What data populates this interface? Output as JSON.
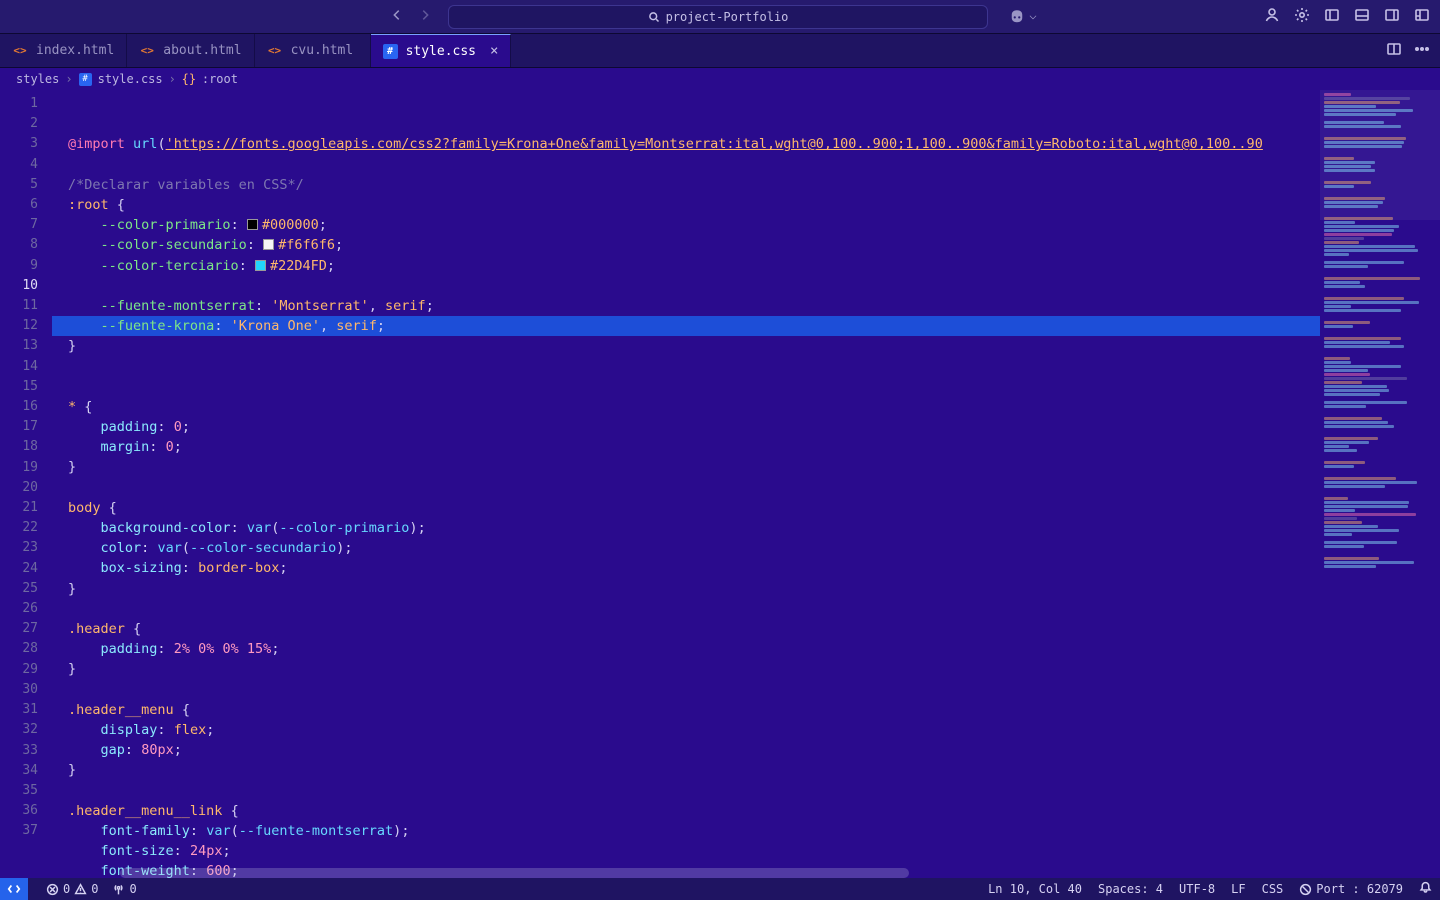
{
  "titlebar": {
    "project": "project-Portfolio"
  },
  "tabs": [
    {
      "label": "index.html",
      "icon": "html",
      "active": false
    },
    {
      "label": "about.html",
      "icon": "html",
      "active": false
    },
    {
      "label": "cvu.html",
      "icon": "html",
      "active": false
    },
    {
      "label": "style.css",
      "icon": "css",
      "active": true,
      "closeable": true
    }
  ],
  "breadcrumb": {
    "folder": "styles",
    "file": "style.css",
    "symbol": ":root"
  },
  "editor": {
    "highlighted_line": 10,
    "lines": [
      {
        "n": 1,
        "tokens": [
          {
            "t": "@import",
            "c": "tok-kw"
          },
          {
            "t": " ",
            "c": ""
          },
          {
            "t": "url",
            "c": "tok-fn"
          },
          {
            "t": "(",
            "c": "tok-punc"
          },
          {
            "t": "'https://fonts.googleapis.com/css2?family=Krona+One&family=Montserrat:ital,wght@0,100..900;1,100..900&family=Roboto:ital,wght@0,100..90",
            "c": "tok-str"
          }
        ]
      },
      {
        "n": 2,
        "tokens": []
      },
      {
        "n": 3,
        "tokens": [
          {
            "t": "/*Declarar variables en CSS*/",
            "c": "tok-com"
          }
        ]
      },
      {
        "n": 4,
        "tokens": [
          {
            "t": ":root",
            "c": "tok-sel"
          },
          {
            "t": " ",
            "c": ""
          },
          {
            "t": "{",
            "c": "tok-punc"
          }
        ]
      },
      {
        "n": 5,
        "indent": 1,
        "tokens": [
          {
            "t": "--color-primario",
            "c": "tok-propv"
          },
          {
            "t": ":",
            "c": "tok-punc"
          },
          {
            "t": " ",
            "c": ""
          },
          {
            "swatch": "#000000"
          },
          {
            "t": "#000000",
            "c": "tok-val"
          },
          {
            "t": ";",
            "c": "tok-punc"
          }
        ]
      },
      {
        "n": 6,
        "indent": 1,
        "tokens": [
          {
            "t": "--color-secundario",
            "c": "tok-propv"
          },
          {
            "t": ":",
            "c": "tok-punc"
          },
          {
            "t": " ",
            "c": ""
          },
          {
            "swatch": "#f6f6f6"
          },
          {
            "t": "#f6f6f6",
            "c": "tok-val"
          },
          {
            "t": ";",
            "c": "tok-punc"
          }
        ]
      },
      {
        "n": 7,
        "indent": 1,
        "tokens": [
          {
            "t": "--color-terciario",
            "c": "tok-propv"
          },
          {
            "t": ":",
            "c": "tok-punc"
          },
          {
            "t": " ",
            "c": ""
          },
          {
            "swatch": "#22D4FD"
          },
          {
            "t": "#22D4FD",
            "c": "tok-val"
          },
          {
            "t": ";",
            "c": "tok-punc"
          }
        ]
      },
      {
        "n": 8,
        "indent": 1,
        "tokens": []
      },
      {
        "n": 9,
        "indent": 1,
        "tokens": [
          {
            "t": "--fuente-montserrat",
            "c": "tok-propv"
          },
          {
            "t": ":",
            "c": "tok-punc"
          },
          {
            "t": " ",
            "c": ""
          },
          {
            "t": "'Montserrat'",
            "c": "tok-str-nou"
          },
          {
            "t": ", ",
            "c": "tok-punc"
          },
          {
            "t": "serif",
            "c": "tok-val"
          },
          {
            "t": ";",
            "c": "tok-punc"
          }
        ]
      },
      {
        "n": 10,
        "indent": 1,
        "tokens": [
          {
            "t": "--fuente-krona",
            "c": "tok-propv"
          },
          {
            "t": ":",
            "c": "tok-punc"
          },
          {
            "t": " ",
            "c": ""
          },
          {
            "t": "'Krona One'",
            "c": "tok-str-nou"
          },
          {
            "t": ", ",
            "c": "tok-punc"
          },
          {
            "t": "serif",
            "c": "tok-val"
          },
          {
            "t": ";",
            "c": "tok-punc"
          }
        ]
      },
      {
        "n": 11,
        "tokens": [
          {
            "t": "}",
            "c": "tok-punc"
          }
        ]
      },
      {
        "n": 12,
        "tokens": []
      },
      {
        "n": 13,
        "tokens": []
      },
      {
        "n": 14,
        "tokens": [
          {
            "t": "*",
            "c": "tok-sel"
          },
          {
            "t": " ",
            "c": ""
          },
          {
            "t": "{",
            "c": "tok-punc"
          }
        ]
      },
      {
        "n": 15,
        "indent": 1,
        "tokens": [
          {
            "t": "padding",
            "c": "tok-prop"
          },
          {
            "t": ":",
            "c": "tok-punc"
          },
          {
            "t": " ",
            "c": ""
          },
          {
            "t": "0",
            "c": "tok-num"
          },
          {
            "t": ";",
            "c": "tok-punc"
          }
        ]
      },
      {
        "n": 16,
        "indent": 1,
        "tokens": [
          {
            "t": "margin",
            "c": "tok-prop"
          },
          {
            "t": ":",
            "c": "tok-punc"
          },
          {
            "t": " ",
            "c": ""
          },
          {
            "t": "0",
            "c": "tok-num"
          },
          {
            "t": ";",
            "c": "tok-punc"
          }
        ]
      },
      {
        "n": 17,
        "tokens": [
          {
            "t": "}",
            "c": "tok-punc"
          }
        ]
      },
      {
        "n": 18,
        "tokens": []
      },
      {
        "n": 19,
        "tokens": [
          {
            "t": "body",
            "c": "tok-sel"
          },
          {
            "t": " ",
            "c": ""
          },
          {
            "t": "{",
            "c": "tok-punc"
          }
        ]
      },
      {
        "n": 20,
        "indent": 1,
        "tokens": [
          {
            "t": "background-color",
            "c": "tok-prop"
          },
          {
            "t": ":",
            "c": "tok-punc"
          },
          {
            "t": " ",
            "c": ""
          },
          {
            "t": "var",
            "c": "tok-fn"
          },
          {
            "t": "(",
            "c": "tok-punc"
          },
          {
            "t": "--color-primario",
            "c": "tok-var"
          },
          {
            "t": ")",
            "c": "tok-punc"
          },
          {
            "t": ";",
            "c": "tok-punc"
          }
        ]
      },
      {
        "n": 21,
        "indent": 1,
        "tokens": [
          {
            "t": "color",
            "c": "tok-prop"
          },
          {
            "t": ":",
            "c": "tok-punc"
          },
          {
            "t": " ",
            "c": ""
          },
          {
            "t": "var",
            "c": "tok-fn"
          },
          {
            "t": "(",
            "c": "tok-punc"
          },
          {
            "t": "--color-secundario",
            "c": "tok-var"
          },
          {
            "t": ")",
            "c": "tok-punc"
          },
          {
            "t": ";",
            "c": "tok-punc"
          }
        ]
      },
      {
        "n": 22,
        "indent": 1,
        "tokens": [
          {
            "t": "box-sizing",
            "c": "tok-prop"
          },
          {
            "t": ":",
            "c": "tok-punc"
          },
          {
            "t": " ",
            "c": ""
          },
          {
            "t": "border-box",
            "c": "tok-val"
          },
          {
            "t": ";",
            "c": "tok-punc"
          }
        ]
      },
      {
        "n": 23,
        "tokens": [
          {
            "t": "}",
            "c": "tok-punc"
          }
        ]
      },
      {
        "n": 24,
        "tokens": []
      },
      {
        "n": 25,
        "tokens": [
          {
            "t": ".header",
            "c": "tok-sel"
          },
          {
            "t": " ",
            "c": ""
          },
          {
            "t": "{",
            "c": "tok-punc"
          }
        ]
      },
      {
        "n": 26,
        "indent": 1,
        "tokens": [
          {
            "t": "padding",
            "c": "tok-prop"
          },
          {
            "t": ":",
            "c": "tok-punc"
          },
          {
            "t": " ",
            "c": ""
          },
          {
            "t": "2%",
            "c": "tok-num"
          },
          {
            "t": " ",
            "c": ""
          },
          {
            "t": "0%",
            "c": "tok-num"
          },
          {
            "t": " ",
            "c": ""
          },
          {
            "t": "0%",
            "c": "tok-num"
          },
          {
            "t": " ",
            "c": ""
          },
          {
            "t": "15%",
            "c": "tok-num"
          },
          {
            "t": ";",
            "c": "tok-punc"
          }
        ]
      },
      {
        "n": 27,
        "tokens": [
          {
            "t": "}",
            "c": "tok-punc"
          }
        ]
      },
      {
        "n": 28,
        "tokens": []
      },
      {
        "n": 29,
        "tokens": [
          {
            "t": ".header__menu",
            "c": "tok-sel"
          },
          {
            "t": " ",
            "c": ""
          },
          {
            "t": "{",
            "c": "tok-punc"
          }
        ]
      },
      {
        "n": 30,
        "indent": 1,
        "tokens": [
          {
            "t": "display",
            "c": "tok-prop"
          },
          {
            "t": ":",
            "c": "tok-punc"
          },
          {
            "t": " ",
            "c": ""
          },
          {
            "t": "flex",
            "c": "tok-val"
          },
          {
            "t": ";",
            "c": "tok-punc"
          }
        ]
      },
      {
        "n": 31,
        "indent": 1,
        "tokens": [
          {
            "t": "gap",
            "c": "tok-prop"
          },
          {
            "t": ":",
            "c": "tok-punc"
          },
          {
            "t": " ",
            "c": ""
          },
          {
            "t": "80px",
            "c": "tok-num"
          },
          {
            "t": ";",
            "c": "tok-punc"
          }
        ]
      },
      {
        "n": 32,
        "tokens": [
          {
            "t": "}",
            "c": "tok-punc"
          }
        ]
      },
      {
        "n": 33,
        "tokens": []
      },
      {
        "n": 34,
        "tokens": [
          {
            "t": ".header__menu__link",
            "c": "tok-sel"
          },
          {
            "t": " ",
            "c": ""
          },
          {
            "t": "{",
            "c": "tok-punc"
          }
        ]
      },
      {
        "n": 35,
        "indent": 1,
        "tokens": [
          {
            "t": "font-family",
            "c": "tok-prop"
          },
          {
            "t": ":",
            "c": "tok-punc"
          },
          {
            "t": " ",
            "c": ""
          },
          {
            "t": "var",
            "c": "tok-fn"
          },
          {
            "t": "(",
            "c": "tok-punc"
          },
          {
            "t": "--fuente-montserrat",
            "c": "tok-var"
          },
          {
            "t": ")",
            "c": "tok-punc"
          },
          {
            "t": ";",
            "c": "tok-punc"
          }
        ]
      },
      {
        "n": 36,
        "indent": 1,
        "tokens": [
          {
            "t": "font-size",
            "c": "tok-prop"
          },
          {
            "t": ":",
            "c": "tok-punc"
          },
          {
            "t": " ",
            "c": ""
          },
          {
            "t": "24px",
            "c": "tok-num"
          },
          {
            "t": ";",
            "c": "tok-punc"
          }
        ]
      },
      {
        "n": 37,
        "indent": 1,
        "tokens": [
          {
            "t": "font-weight",
            "c": "tok-prop"
          },
          {
            "t": ":",
            "c": "tok-punc"
          },
          {
            "t": " ",
            "c": ""
          },
          {
            "t": "600",
            "c": "tok-num"
          },
          {
            "t": ";",
            "c": "tok-punc"
          }
        ]
      }
    ]
  },
  "statusbar": {
    "errors": "0",
    "warnings": "0",
    "ports": "0",
    "cursor": "Ln 10, Col 40",
    "spaces": "Spaces: 4",
    "encoding": "UTF-8",
    "eol": "LF",
    "lang": "CSS",
    "port": "Port : 62079"
  }
}
